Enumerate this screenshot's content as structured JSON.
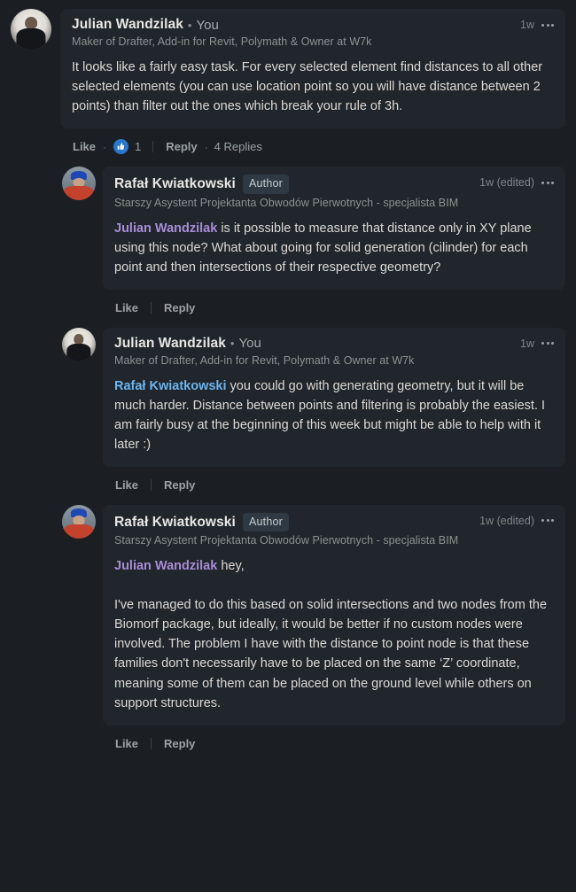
{
  "thread": {
    "comments": [
      {
        "id": "c1",
        "nested": false,
        "avatar": "julian-avatar",
        "author": "Julian Wandzilak",
        "separator": "•",
        "you_tag": "You",
        "badge": null,
        "headline": "Maker of Drafter, Add-in for Revit, Polymath & Owner at W7k",
        "time": "1w",
        "menu_icon": "more-options-icon",
        "body": [
          {
            "type": "text",
            "value": "It looks like a fairly easy task. For every selected element find distances to all other selected elements (you can use location point so you will have distance between 2 points) than filter out the ones which break your rule of 3h."
          }
        ],
        "actions": {
          "like_label": "Like",
          "reply_label": "Reply",
          "reaction": {
            "icon": "thumbs-up-icon",
            "count": "1",
            "color": "#2878cc"
          },
          "replies_label": "4 Replies",
          "has_reaction": true,
          "has_replies": true,
          "divider": "vertical"
        }
      },
      {
        "id": "c2",
        "nested": true,
        "avatar": "rafal-avatar",
        "author": "Rafał Kwiatkowski",
        "separator": null,
        "you_tag": null,
        "badge": "Author",
        "headline": "Starszy Asystent Projektanta Obwodów Pierwotnych - specjalista BIM",
        "time": "1w (edited)",
        "menu_icon": "more-options-icon",
        "body": [
          {
            "type": "mention",
            "value": "Julian Wandzilak",
            "color": "violet"
          },
          {
            "type": "text",
            "value": " is it possible to measure that distance only in XY plane using this node? What about going for solid generation (cilinder) for each point and then intersections of their respective geometry?"
          }
        ],
        "actions": {
          "like_label": "Like",
          "reply_label": "Reply",
          "reaction": null,
          "replies_label": null,
          "has_reaction": false,
          "has_replies": false,
          "divider": "vertical"
        }
      },
      {
        "id": "c3",
        "nested": true,
        "avatar": "julian-avatar",
        "author": "Julian Wandzilak",
        "separator": "•",
        "you_tag": "You",
        "badge": null,
        "headline": "Maker of Drafter, Add-in for Revit, Polymath & Owner at W7k",
        "time": "1w",
        "menu_icon": "more-options-icon",
        "body": [
          {
            "type": "mention",
            "value": "Rafał Kwiatkowski",
            "color": "blue"
          },
          {
            "type": "text",
            "value": " you could go with generating geometry, but it will be much harder. Distance between points and filtering is probably the easiest. I am fairly busy at the beginning of this week but might be able to help with it later :)"
          }
        ],
        "actions": {
          "like_label": "Like",
          "reply_label": "Reply",
          "reaction": null,
          "replies_label": null,
          "has_reaction": false,
          "has_replies": false,
          "divider": "vertical"
        }
      },
      {
        "id": "c4",
        "nested": true,
        "avatar": "rafal-avatar",
        "author": "Rafał Kwiatkowski",
        "separator": null,
        "you_tag": null,
        "badge": "Author",
        "headline": "Starszy Asystent Projektanta Obwodów Pierwotnych - specjalista BIM",
        "time": "1w (edited)",
        "menu_icon": "more-options-icon",
        "body": [
          {
            "type": "mention",
            "value": "Julian Wandzilak",
            "color": "violet"
          },
          {
            "type": "text",
            "value": " hey,\n\nI've managed to do this based on solid intersections and two nodes from the Biomorf package, but ideally, it would be better if no custom nodes were involved. The problem I have with the distance to point node is that these families don't necessarily have to be placed on the same ‘Z’ coordinate, meaning some of them can be placed on the ground level while others on support structures."
          }
        ],
        "actions": {
          "like_label": "Like",
          "reply_label": "Reply",
          "reaction": null,
          "replies_label": null,
          "has_reaction": false,
          "has_replies": false,
          "divider": "vertical"
        }
      }
    ]
  },
  "theme": {
    "page_background": "#1b1f23",
    "bubble_background": "#20262b",
    "primary_text": "#ddd9d5",
    "secondary_text": "#8d9193",
    "mention_blue": "#6bb6f0",
    "mention_violet": "#a98cd8",
    "badge_background": "#2e3943",
    "reaction_blue": "#2878cc"
  }
}
